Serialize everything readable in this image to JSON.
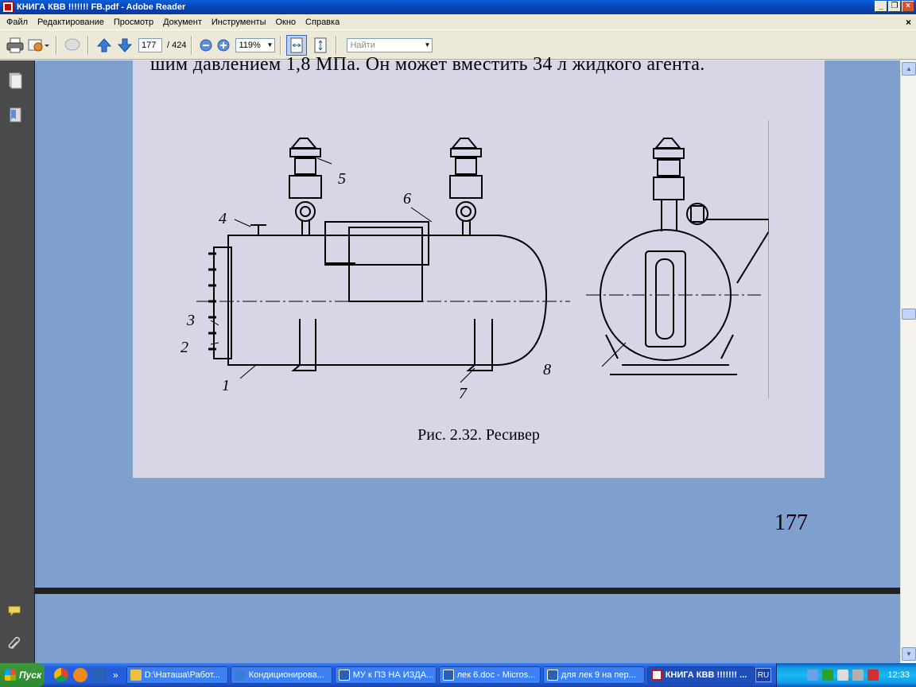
{
  "window": {
    "title": "КНИГА КВВ !!!!!!! FB.pdf - Adobe Reader",
    "minimize": "_",
    "restore": "❐",
    "close": "×"
  },
  "menu": {
    "items": [
      "Файл",
      "Редактирование",
      "Просмотр",
      "Документ",
      "Инструменты",
      "Окно",
      "Справка"
    ],
    "doc_close": "×"
  },
  "toolbar": {
    "page_current": "177",
    "page_total": "/ 424",
    "zoom": "119%",
    "search_placeholder": "Найти"
  },
  "page": {
    "top_text": "шим давлением 1,8 МПа. Он может вместить 34 л жидкого агента.",
    "caption": "Рис. 2.32. Ресивер",
    "page_number": "177",
    "callouts": [
      "1",
      "2",
      "3",
      "4",
      "5",
      "6",
      "7",
      "8"
    ]
  },
  "taskbar": {
    "start_label": "Пуск",
    "tasks": [
      {
        "label": "D:\\Наташа\\Работ...",
        "icon_color": "#f0c040"
      },
      {
        "label": "Кондиционирова...",
        "icon_color": "#3a7bd5"
      },
      {
        "label": "МУ к ПЗ НА ИЗДА...",
        "icon_color": "#2b5fb4"
      },
      {
        "label": "лек 6.doc - Micros...",
        "icon_color": "#2b5fb4"
      },
      {
        "label": "для лек 9 на пер...",
        "icon_color": "#2b5fb4"
      },
      {
        "label": "КНИГА КВВ !!!!!!! ...",
        "icon_color": "#cc1111"
      }
    ],
    "language": "RU",
    "help": "?",
    "clock": "12:33"
  }
}
